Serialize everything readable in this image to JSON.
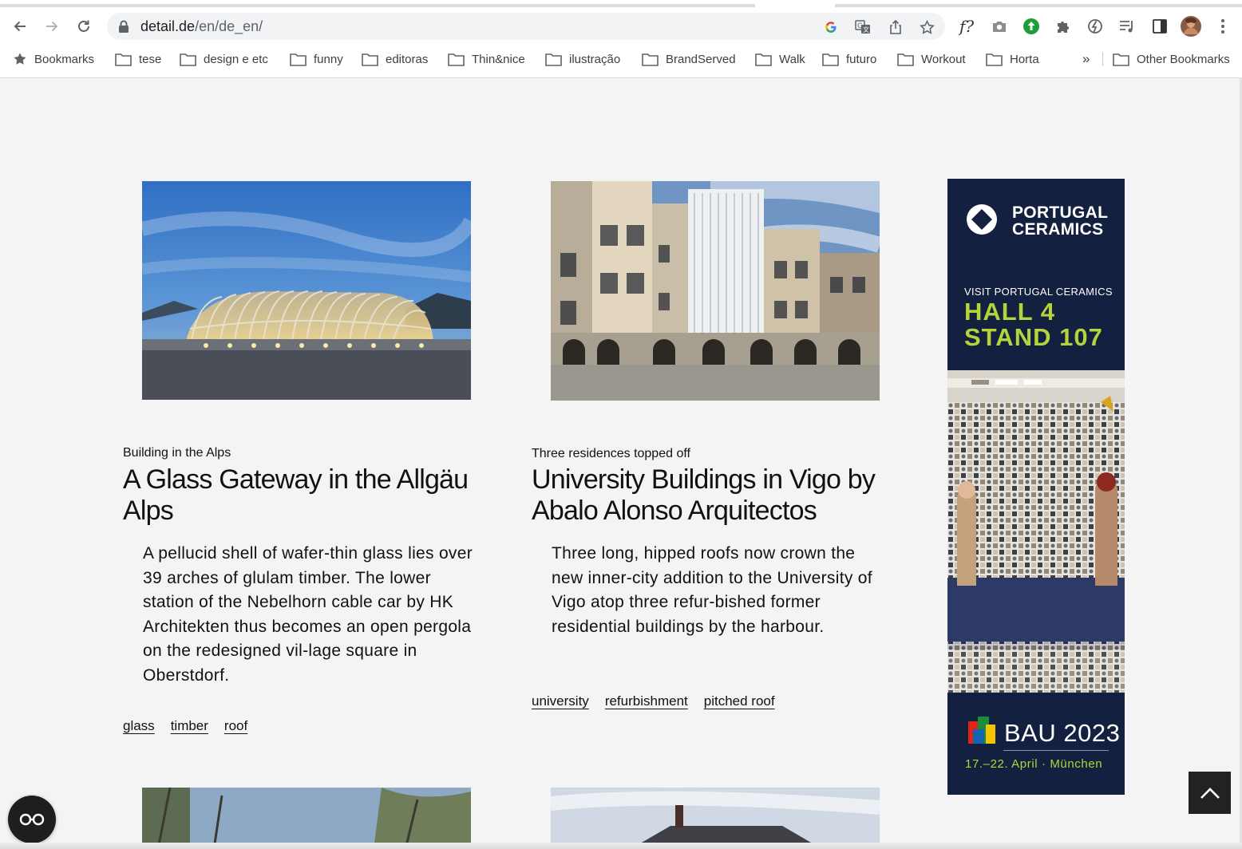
{
  "browser": {
    "url_host": "detail.de",
    "url_path": "/en/de_en/",
    "bookmarks": [
      "Bookmarks",
      "tese",
      "design e etc",
      "funny",
      "editoras",
      "Thin&nice",
      "ilustração",
      "BrandServed",
      "Walk",
      "futuro",
      "Workout",
      "Horta"
    ],
    "bookmarks_overflow": "»",
    "other_bookmarks": "Other Bookmarks",
    "fx_label": "f?"
  },
  "articles": [
    {
      "kicker": "Building in the Alps",
      "title": "A Glass Gateway in the Allgäu Alps",
      "excerpt": "A pellucid shell of wafer-thin glass lies over 39 arches of glulam timber. The lower station of the Nebelhorn cable car by HK Architekten thus becomes an open pergola on the redesigned vil-lage square in Oberstdorf.",
      "tags": [
        "glass",
        "timber",
        "roof"
      ]
    },
    {
      "kicker": "Three residences topped off",
      "title": "University Buildings in Vigo by Abalo Alonso Arquitectos",
      "excerpt": "Three long, hipped roofs now crown the new inner-city addition to the University of Vigo atop three refur-bished former residential buildings by the harbour.",
      "tags": [
        "university",
        "refurbishment",
        "pitched roof"
      ]
    }
  ],
  "ad": {
    "brand_line1": "PORTUGAL",
    "brand_line2": "CERAMICS",
    "visit": "VISIT PORTUGAL CERAMICS",
    "hall": "HALL 4",
    "stand": "STAND 107",
    "bau": "BAU 2023",
    "dates": "17.–22. April · München"
  },
  "colors": {
    "page_bg": "#f4f4f4",
    "ad_bg": "#14203f",
    "ad_accent": "#b5d33a",
    "text": "#111111"
  }
}
